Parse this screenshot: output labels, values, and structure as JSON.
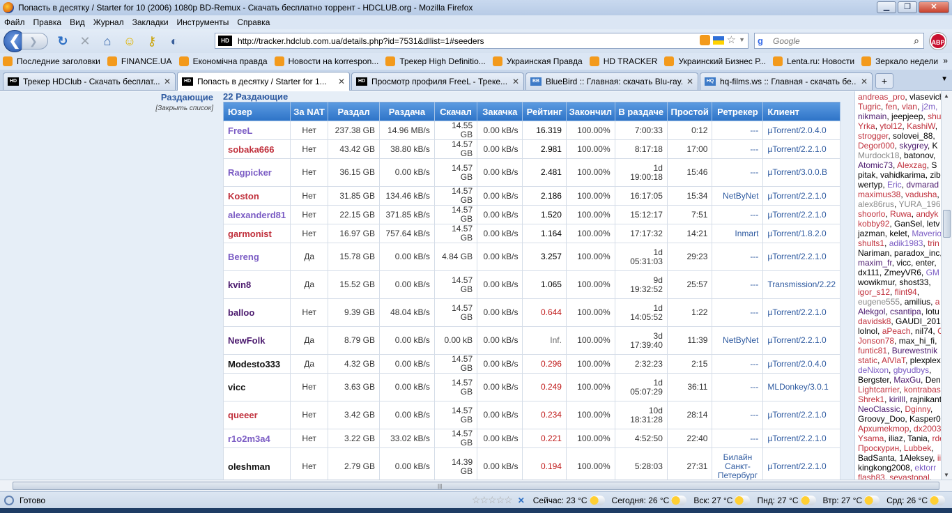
{
  "window": {
    "title": "Попасть в десятку / Starter for 10 (2006) 1080p BD-Remux - Скачать бесплатно торрент - HDCLUB.org - Mozilla Firefox",
    "min": "▁",
    "max": "❐",
    "close": "✕"
  },
  "menu": [
    "Файл",
    "Правка",
    "Вид",
    "Журнал",
    "Закладки",
    "Инструменты",
    "Справка"
  ],
  "nav": {
    "back": "❮",
    "forward": "❯",
    "url": "http://tracker.hdclub.com.ua/details.php?id=7531&dllist=1#seeders",
    "site_icon": "HD",
    "search_placeholder": "Google",
    "search_engine": "g",
    "abp": "ABP"
  },
  "bookmarks": [
    "Последние заголовки",
    "FINANCE.UA",
    "Економічна правда",
    "Новости на korrespon...",
    "Трекер High Definitio...",
    "Украинская Правда",
    "HD TRACKER",
    "Украинский Бизнес Р...",
    "Lenta.ru: Новости",
    "Зеркало недели"
  ],
  "bookmarks_more": "»",
  "tabs": [
    {
      "label": "Трекер HDClub - Скачать бесплат...",
      "icon": "HD",
      "active": false
    },
    {
      "label": "Попасть в десятку / Starter for 1...",
      "icon": "HD",
      "active": true
    },
    {
      "label": "Просмотр профиля FreeL - Треке...",
      "icon": "HD",
      "active": false
    },
    {
      "label": "BlueBird :: Главная: скачать Blu-ray...",
      "icon": "BB",
      "active": false
    },
    {
      "label": "hq-films.ws :: Главная - скачать бе...",
      "icon": "HQ",
      "active": false
    }
  ],
  "tab_close": "✕",
  "newtab": "+",
  "tabs_more": "▼",
  "section": {
    "label": "Раздающие",
    "close_list": "[Закрыть список]",
    "count_title": "22 Раздающие"
  },
  "table": {
    "headers": [
      "Юзер",
      "За NAT",
      "Раздал",
      "Раздача",
      "Скачал",
      "Закачка",
      "Рейтинг",
      "Закончил",
      "В раздаче",
      "Простой",
      "Ретрекер",
      "Клиент"
    ],
    "rows": [
      {
        "user": "FreeL",
        "color": "#7b5cc4",
        "nat": "Нет",
        "up": "237.38 GB",
        "upspeed": "14.96 MB/s",
        "down": "14.55 GB",
        "dlspeed": "0.00 kB/s",
        "rating": "16.319",
        "rclass": "",
        "done": "100.00%",
        "seed": [
          "7:00:33"
        ],
        "idle": "0:12",
        "tracker": [
          "---"
        ],
        "client": "µTorrent/2.0.4.0",
        "h": 26
      },
      {
        "user": "sobaka666",
        "color": "#c0303c",
        "nat": "Нет",
        "up": "43.42 GB",
        "upspeed": "38.80 kB/s",
        "down": "14.57 GB",
        "dlspeed": "0.00 kB/s",
        "rating": "2.981",
        "rclass": "",
        "done": "100.00%",
        "seed": [
          "8:17:18"
        ],
        "idle": "17:00",
        "tracker": [
          "---"
        ],
        "client": "µTorrent/2.2.1.0",
        "h": 26
      },
      {
        "user": "Ragpicker",
        "color": "#7b5cc4",
        "nat": "Нет",
        "up": "36.15 GB",
        "upspeed": "0.00 kB/s",
        "down": "14.57 GB",
        "dlspeed": "0.00 kB/s",
        "rating": "2.481",
        "rclass": "",
        "done": "100.00%",
        "seed": [
          "1d",
          "19:00:18"
        ],
        "idle": "15:46",
        "tracker": [
          "---"
        ],
        "client": "µTorrent/3.0.0.B",
        "h": 40
      },
      {
        "user": "Koston",
        "color": "#c0303c",
        "nat": "Нет",
        "up": "31.85 GB",
        "upspeed": "134.46 kB/s",
        "down": "14.57 GB",
        "dlspeed": "0.00 kB/s",
        "rating": "2.186",
        "rclass": "",
        "done": "100.00%",
        "seed": [
          "16:17:05"
        ],
        "idle": "15:34",
        "tracker": [
          "NetByNet"
        ],
        "client": "µTorrent/2.2.1.0",
        "h": 26
      },
      {
        "user": "alexanderd81",
        "color": "#7b5cc4",
        "nat": "Нет",
        "up": "22.15 GB",
        "upspeed": "371.85 kB/s",
        "down": "14.57 GB",
        "dlspeed": "0.00 kB/s",
        "rating": "1.520",
        "rclass": "",
        "done": "100.00%",
        "seed": [
          "15:12:17"
        ],
        "idle": "7:51",
        "tracker": [
          "---"
        ],
        "client": "µTorrent/2.2.1.0",
        "h": 26
      },
      {
        "user": "garmonist",
        "color": "#c0303c",
        "nat": "Нет",
        "up": "16.97 GB",
        "upspeed": "757.64 kB/s",
        "down": "14.57 GB",
        "dlspeed": "0.00 kB/s",
        "rating": "1.164",
        "rclass": "",
        "done": "100.00%",
        "seed": [
          "17:17:32"
        ],
        "idle": "14:21",
        "tracker": [
          "Inmart"
        ],
        "client": "µTorrent/1.8.2.0",
        "h": 26
      },
      {
        "user": "Bereng",
        "color": "#7b5cc4",
        "nat": "Да",
        "up": "15.78 GB",
        "upspeed": "0.00 kB/s",
        "down": "4.84 GB",
        "dlspeed": "0.00 kB/s",
        "rating": "3.257",
        "rclass": "",
        "done": "100.00%",
        "seed": [
          "1d",
          "05:31:03"
        ],
        "idle": "29:23",
        "tracker": [
          "---"
        ],
        "client": "µTorrent/2.2.1.0",
        "h": 40
      },
      {
        "user": "kvin8",
        "color": "#4b1a6e",
        "nat": "Да",
        "up": "15.52 GB",
        "upspeed": "0.00 kB/s",
        "down": "14.57 GB",
        "dlspeed": "0.00 kB/s",
        "rating": "1.065",
        "rclass": "",
        "done": "100.00%",
        "seed": [
          "9d",
          "19:32:52"
        ],
        "idle": "25:57",
        "tracker": [
          "---"
        ],
        "client": "Transmission/2.22",
        "h": 40
      },
      {
        "user": "balloo",
        "color": "#4b1a6e",
        "nat": "Нет",
        "up": "9.39 GB",
        "upspeed": "48.04 kB/s",
        "down": "14.57 GB",
        "dlspeed": "0.00 kB/s",
        "rating": "0.644",
        "rclass": "low",
        "done": "100.00%",
        "seed": [
          "1d",
          "14:05:52"
        ],
        "idle": "1:22",
        "tracker": [
          "---"
        ],
        "client": "µTorrent/2.2.1.0",
        "h": 40
      },
      {
        "user": "NewFolk",
        "color": "#4b1a6e",
        "nat": "Да",
        "up": "8.79 GB",
        "upspeed": "0.00 kB/s",
        "down": "0.00 kB",
        "dlspeed": "0.00 kB/s",
        "rating": "Inf.",
        "rclass": "inf",
        "done": "100.00%",
        "seed": [
          "3d",
          "17:39:40"
        ],
        "idle": "11:39",
        "tracker": [
          "NetByNet"
        ],
        "client": "µTorrent/2.2.1.0",
        "h": 40
      },
      {
        "user": "Modesto333",
        "color": "#111111",
        "nat": "Да",
        "up": "4.32 GB",
        "upspeed": "0.00 kB/s",
        "down": "14.57 GB",
        "dlspeed": "0.00 kB/s",
        "rating": "0.296",
        "rclass": "low",
        "done": "100.00%",
        "seed": [
          "2:32:23"
        ],
        "idle": "2:15",
        "tracker": [
          "---"
        ],
        "client": "µTorrent/2.0.4.0",
        "h": 26
      },
      {
        "user": "vicc",
        "color": "#111111",
        "nat": "Нет",
        "up": "3.63 GB",
        "upspeed": "0.00 kB/s",
        "down": "14.57 GB",
        "dlspeed": "0.00 kB/s",
        "rating": "0.249",
        "rclass": "low",
        "done": "100.00%",
        "seed": [
          "1d",
          "05:07:29"
        ],
        "idle": "36:11",
        "tracker": [
          "---"
        ],
        "client": "MLDonkey/3.0.1",
        "h": 40
      },
      {
        "user": "queeer",
        "color": "#c0303c",
        "nat": "Нет",
        "up": "3.42 GB",
        "upspeed": "0.00 kB/s",
        "down": "14.57 GB",
        "dlspeed": "0.00 kB/s",
        "rating": "0.234",
        "rclass": "low",
        "done": "100.00%",
        "seed": [
          "10d",
          "18:31:28"
        ],
        "idle": "28:14",
        "tracker": [
          "---"
        ],
        "client": "µTorrent/2.2.1.0",
        "h": 40
      },
      {
        "user": "r1o2m3a4",
        "color": "#7b5cc4",
        "nat": "Нет",
        "up": "3.22 GB",
        "upspeed": "33.02 kB/s",
        "down": "14.57 GB",
        "dlspeed": "0.00 kB/s",
        "rating": "0.221",
        "rclass": "low",
        "done": "100.00%",
        "seed": [
          "4:52:50"
        ],
        "idle": "22:40",
        "tracker": [
          "---"
        ],
        "client": "µTorrent/2.2.1.0",
        "h": 26
      },
      {
        "user": "oleshman",
        "color": "#111111",
        "nat": "Нет",
        "up": "2.79 GB",
        "upspeed": "0.00 kB/s",
        "down": "14.39 GB",
        "dlspeed": "0.00 kB/s",
        "rating": "0.194",
        "rclass": "low",
        "done": "100.00%",
        "seed": [
          "5:28:03"
        ],
        "idle": "27:31",
        "tracker": [
          "Билайн",
          "Санкт-",
          "Петербург"
        ],
        "client": "µTorrent/2.2.1.0",
        "h": 54
      }
    ]
  },
  "sidebar_lines": [
    [
      [
        "andreas_pro",
        "#c0303c"
      ],
      [
        ", vlasevich",
        "#000"
      ]
    ],
    [
      [
        "Tugric",
        "#c0303c"
      ],
      [
        ", ",
        "#000"
      ],
      [
        "fen",
        "#c0303c"
      ],
      [
        ", ",
        "#000"
      ],
      [
        "vlan",
        "#c0303c"
      ],
      [
        ", ",
        "#000"
      ],
      [
        "j2m,",
        "#7b5cc4"
      ]
    ],
    [
      [
        "nikmain",
        "#4b1a6e"
      ],
      [
        ", jeepjeep, ",
        "#000"
      ],
      [
        "shu",
        "#c0303c"
      ]
    ],
    [
      [
        "Yrka",
        "#c0303c"
      ],
      [
        ", ",
        "#000"
      ],
      [
        "ytol12",
        "#c0303c"
      ],
      [
        ", ",
        "#000"
      ],
      [
        "KashiW",
        "#c0303c"
      ],
      [
        ", ",
        "#000"
      ]
    ],
    [
      [
        "strogger",
        "#c0303c"
      ],
      [
        ", solovei_88,",
        "#000"
      ]
    ],
    [
      [
        "Degor000",
        "#c0303c"
      ],
      [
        ", ",
        "#000"
      ],
      [
        "skygrey",
        "#4b1a6e"
      ],
      [
        ", K",
        "#000"
      ]
    ],
    [
      [
        "Murdock18",
        "#888"
      ],
      [
        ", batonov, ",
        "#000"
      ]
    ],
    [
      [
        "Atomic73",
        "#4b1a6e"
      ],
      [
        ", ",
        "#000"
      ],
      [
        "Alexzag",
        "#c0303c"
      ],
      [
        ", S",
        "#000"
      ]
    ],
    [
      [
        "pitak, vahidkarima, zib",
        "#000"
      ]
    ],
    [
      [
        "wertyp, ",
        "#000"
      ],
      [
        "Eric",
        "#7b5cc4"
      ],
      [
        ", ",
        "#000"
      ],
      [
        "dvmarad",
        "#4b1a6e"
      ]
    ],
    [
      [
        "maximus38",
        "#c0303c"
      ],
      [
        ", ",
        "#000"
      ],
      [
        "vadusha",
        "#c0303c"
      ],
      [
        ",",
        "#000"
      ]
    ],
    [
      [
        "alex86rus",
        "#888"
      ],
      [
        ", ",
        "#000"
      ],
      [
        "YURA_196",
        "#888"
      ]
    ],
    [
      [
        "shoorlo",
        "#c0303c"
      ],
      [
        ", ",
        "#000"
      ],
      [
        "Ruwa",
        "#c0303c"
      ],
      [
        ", ",
        "#000"
      ],
      [
        "andyk",
        "#c0303c"
      ]
    ],
    [
      [
        "kobby92",
        "#c0303c"
      ],
      [
        ", GanSel, letv",
        "#000"
      ]
    ],
    [
      [
        "jazman, kelet, ",
        "#000"
      ],
      [
        "Maverio",
        "#7b5cc4"
      ]
    ],
    [
      [
        "shults1",
        "#c0303c"
      ],
      [
        ", ",
        "#000"
      ],
      [
        "adik1983",
        "#7b5cc4"
      ],
      [
        ", ",
        "#000"
      ],
      [
        "trin",
        "#c0303c"
      ]
    ],
    [
      [
        "Nariman, paradox_inc,",
        "#000"
      ]
    ],
    [
      [
        "maxim_fr",
        "#4b1a6e"
      ],
      [
        ", vicc, enter,",
        "#000"
      ]
    ],
    [
      [
        "dx111, ZmeyVR6, ",
        "#000"
      ],
      [
        "GM",
        "#7b5cc4"
      ]
    ],
    [
      [
        "wowikmur, shost33,",
        "#000"
      ]
    ],
    [
      [
        "igor_s12",
        "#c0303c"
      ],
      [
        ", ",
        "#000"
      ],
      [
        "flint94",
        "#c0303c"
      ],
      [
        ",",
        "#000"
      ]
    ],
    [
      [
        "eugene555",
        "#888"
      ],
      [
        ", amilius, ",
        "#000"
      ],
      [
        "a",
        "#c0303c"
      ]
    ],
    [
      [
        "Alekgol",
        "#4b1a6e"
      ],
      [
        ", ",
        "#000"
      ],
      [
        "csantipa",
        "#4b1a6e"
      ],
      [
        ", lotu",
        "#000"
      ]
    ],
    [
      [
        "davidsk8",
        "#c0303c"
      ],
      [
        ", GAUDI_201",
        "#000"
      ]
    ],
    [
      [
        "lolnol, ",
        "#000"
      ],
      [
        "aPeach",
        "#c0303c"
      ],
      [
        ", nil74, ",
        "#000"
      ],
      [
        "C",
        "#c0303c"
      ]
    ],
    [
      [
        "Jonson78",
        "#c0303c"
      ],
      [
        ", max_hi_fi,",
        "#000"
      ]
    ],
    [
      [
        "funtic81",
        "#c0303c"
      ],
      [
        ", ",
        "#000"
      ],
      [
        "Burewestnik",
        "#4b1a6e"
      ]
    ],
    [
      [
        "static",
        "#c0303c"
      ],
      [
        ", ",
        "#000"
      ],
      [
        "AlVlaT",
        "#c0303c"
      ],
      [
        ", plexplex",
        "#000"
      ]
    ],
    [
      [
        "deNixon",
        "#7b5cc4"
      ],
      [
        ", ",
        "#000"
      ],
      [
        "gbyudbys",
        "#7b5cc4"
      ],
      [
        ",",
        "#000"
      ]
    ],
    [
      [
        "Bergster, ",
        "#000"
      ],
      [
        "MaxGu",
        "#4b1a6e"
      ],
      [
        ", Den",
        "#000"
      ]
    ],
    [
      [
        "Lightcarrier",
        "#c0303c"
      ],
      [
        ", ",
        "#000"
      ],
      [
        "kontrabas",
        "#c0303c"
      ]
    ],
    [
      [
        "Shrek1",
        "#c0303c"
      ],
      [
        ", ",
        "#000"
      ],
      [
        "kirilll",
        "#4b1a6e"
      ],
      [
        ", rajnikant",
        "#000"
      ]
    ],
    [
      [
        "NeoClassic",
        "#4b1a6e"
      ],
      [
        ", ",
        "#000"
      ],
      [
        "Dginny",
        "#c0303c"
      ],
      [
        ",",
        "#000"
      ]
    ],
    [
      [
        "Groovy_Doo, Kasper0",
        "#000"
      ]
    ],
    [
      [
        "Apxumekmop",
        "#c0303c"
      ],
      [
        ", ",
        "#000"
      ],
      [
        "dx2003",
        "#c0303c"
      ]
    ],
    [
      [
        "Ysama",
        "#c0303c"
      ],
      [
        ", iliaz, Tania, ",
        "#000"
      ],
      [
        "rde",
        "#c0303c"
      ]
    ],
    [
      [
        "Проскурин",
        "#c0303c"
      ],
      [
        ", ",
        "#000"
      ],
      [
        "Lubbek",
        "#c0303c"
      ],
      [
        ",",
        "#000"
      ]
    ],
    [
      [
        "BadSanta, 1Aleksey, ",
        "#000"
      ],
      [
        "ii",
        "#c0303c"
      ]
    ],
    [
      [
        "kingkong2008, ",
        "#000"
      ],
      [
        "ektorr",
        "#7b5cc4"
      ]
    ],
    [
      [
        "flash83",
        "#c0303c"
      ],
      [
        ", ",
        "#000"
      ],
      [
        "sevastopal",
        "#c0303c"
      ],
      [
        ",",
        "#000"
      ]
    ]
  ],
  "status": {
    "text": "Готово",
    "stars": "☆☆☆☆☆",
    "weather": [
      {
        "label": "Сейчас: 23 °C"
      },
      {
        "label": "Сегодня: 26 °C"
      },
      {
        "label": "Вск: 27 °C"
      },
      {
        "label": "Пнд: 27 °C"
      },
      {
        "label": "Втр: 27 °C"
      },
      {
        "label": "Срд: 26 °C"
      }
    ]
  },
  "colors": {
    "header_bg": "#2d73c7",
    "nat_no": "#1b8a1b",
    "nat_yes": "#c01b1b",
    "low_rating": "#c01b1b",
    "link": "#2e5aa0"
  }
}
